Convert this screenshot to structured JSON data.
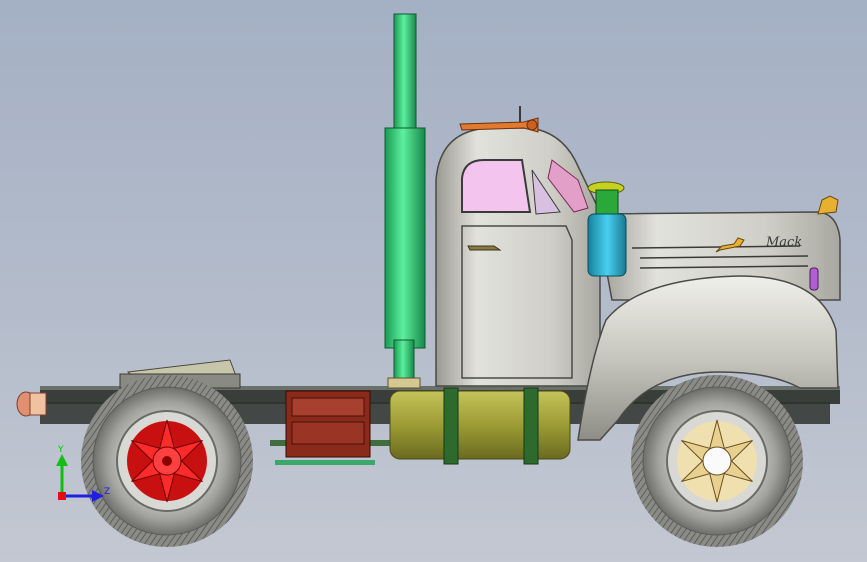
{
  "viewport": {
    "background_top": "#a4b0c4",
    "background_bottom": "#c3c8d2"
  },
  "model": {
    "hood_badge_text": "Mack",
    "parts": {
      "cab": "#c8c8c0",
      "window_glass": "#f2c4ee",
      "exhaust_stack": "#34d47c",
      "air_cleaner": "#2aa8c8",
      "fuel_tank": "#a8a83a",
      "battery_box": "#8a2a1a",
      "rear_hub": "#e01010",
      "front_hub": "#e8d8a0",
      "tire": "#9a9a96",
      "frame": "#3a3e3a",
      "horn": "#e07a30",
      "marker_light": "#b060d0"
    }
  },
  "triad": {
    "y_label": "Y",
    "z_label": "Z",
    "y_color": "#10c010",
    "z_color": "#2020e0",
    "x_color": "#e01010"
  }
}
